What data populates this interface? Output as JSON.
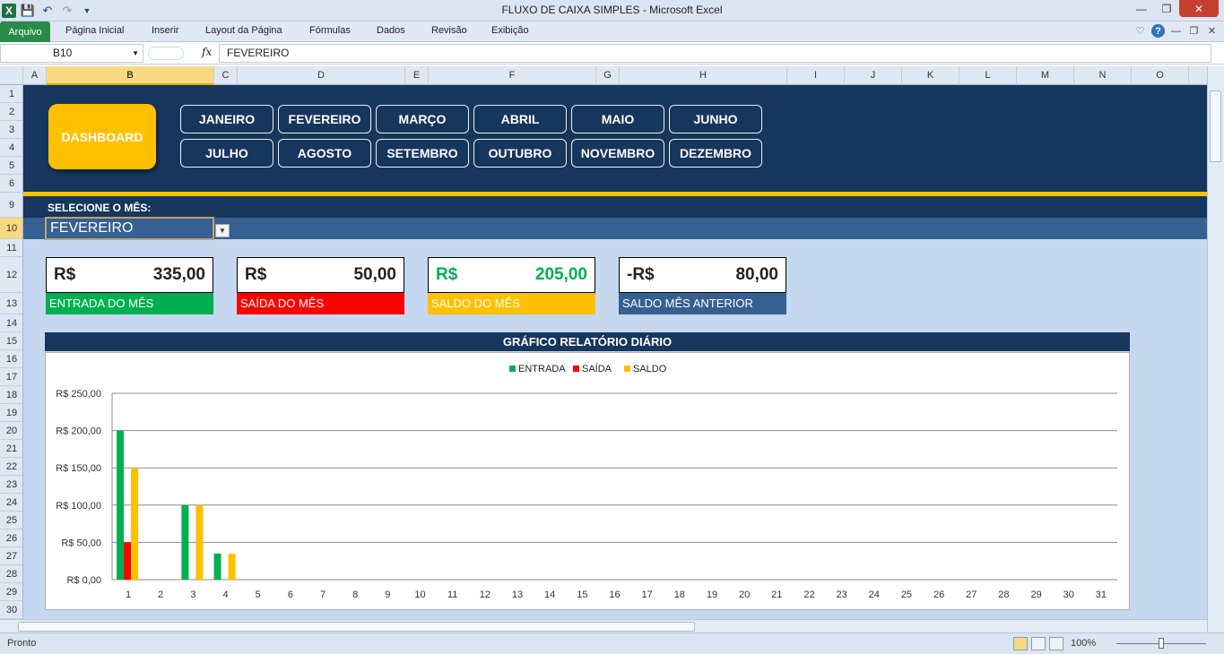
{
  "window": {
    "title": "FLUXO DE CAIXA SIMPLES  -  Microsoft Excel",
    "icons": [
      "excel-icon",
      "save-icon",
      "undo-icon",
      "redo-icon",
      "customize-icon"
    ]
  },
  "ribbon": {
    "file_tab": "Arquivo",
    "tabs": [
      "Página Inicial",
      "Inserir",
      "Layout da Página",
      "Fórmulas",
      "Dados",
      "Revisão",
      "Exibição"
    ]
  },
  "formula_bar": {
    "name_box": "B10",
    "fx": "fx",
    "value": "FEVEREIRO"
  },
  "columns": [
    "A",
    "B",
    "C",
    "D",
    "E",
    "F",
    "G",
    "H",
    "I",
    "J",
    "K",
    "L",
    "M",
    "N",
    "O"
  ],
  "rows": [
    "1",
    "2",
    "3",
    "4",
    "5",
    "6",
    "9",
    "10",
    "11",
    "12",
    "13",
    "14",
    "15",
    "16",
    "17",
    "18",
    "19",
    "20",
    "21",
    "22",
    "23",
    "24",
    "25",
    "26",
    "27",
    "28",
    "29",
    "30"
  ],
  "dashboard": {
    "dashboard_button": "DASHBOARD",
    "months": [
      "JANEIRO",
      "FEVEREIRO",
      "MARÇO",
      "ABRIL",
      "MAIO",
      "JUNHO",
      "JULHO",
      "AGOSTO",
      "SETEMBRO",
      "OUTUBRO",
      "NOVEMBRO",
      "DEZEMBRO"
    ],
    "select_label": "SELECIONE O MÊS:",
    "selected_month": "FEVEREIRO"
  },
  "kpis": [
    {
      "currency": "R$",
      "value": "335,00",
      "label": "ENTRADA DO MÊS",
      "color": "#00b050",
      "value_color": "#000000"
    },
    {
      "currency": "R$",
      "value": "50,00",
      "label": "SAÍDA DO MÊS",
      "color": "#ff0000",
      "value_color": "#000000"
    },
    {
      "currency": "R$",
      "value": "205,00",
      "label": "SALDO DO MÊS",
      "color": "#ffc000",
      "value_color": "#00b050"
    },
    {
      "currency": "-R$",
      "value": "80,00",
      "label": "SALDO MÊS ANTERIOR",
      "color": "#366092",
      "value_color": "#000000"
    }
  ],
  "chart_data": {
    "type": "bar",
    "title": "GRÁFICO RELATÓRIO DIÁRIO",
    "categories": [
      "1",
      "2",
      "3",
      "4",
      "5",
      "6",
      "7",
      "8",
      "9",
      "10",
      "11",
      "12",
      "13",
      "14",
      "15",
      "16",
      "17",
      "18",
      "19",
      "20",
      "21",
      "22",
      "23",
      "24",
      "25",
      "26",
      "27",
      "28",
      "29",
      "30",
      "31"
    ],
    "series": [
      {
        "name": "ENTRADA",
        "color": "#00b050",
        "values": [
          200,
          0,
          100,
          35,
          0,
          0,
          0,
          0,
          0,
          0,
          0,
          0,
          0,
          0,
          0,
          0,
          0,
          0,
          0,
          0,
          0,
          0,
          0,
          0,
          0,
          0,
          0,
          0,
          0,
          0,
          0
        ]
      },
      {
        "name": "SAÍDA",
        "color": "#ff0000",
        "values": [
          50,
          0,
          0,
          0,
          0,
          0,
          0,
          0,
          0,
          0,
          0,
          0,
          0,
          0,
          0,
          0,
          0,
          0,
          0,
          0,
          0,
          0,
          0,
          0,
          0,
          0,
          0,
          0,
          0,
          0,
          0
        ]
      },
      {
        "name": "SALDO",
        "color": "#ffc000",
        "values": [
          150,
          0,
          100,
          35,
          0,
          0,
          0,
          0,
          0,
          0,
          0,
          0,
          0,
          0,
          0,
          0,
          0,
          0,
          0,
          0,
          0,
          0,
          0,
          0,
          0,
          0,
          0,
          0,
          0,
          0,
          0
        ]
      }
    ],
    "ylim": [
      0,
      250
    ],
    "yticks": [
      "R$ 0,00",
      "R$ 50,00",
      "R$ 100,00",
      "R$ 150,00",
      "R$ 200,00",
      "R$ 250,00"
    ],
    "ytick_values": [
      0,
      50,
      100,
      150,
      200,
      250
    ],
    "grid": true,
    "legend": "top-center"
  },
  "status": {
    "ready": "Pronto",
    "zoom": "100%"
  }
}
